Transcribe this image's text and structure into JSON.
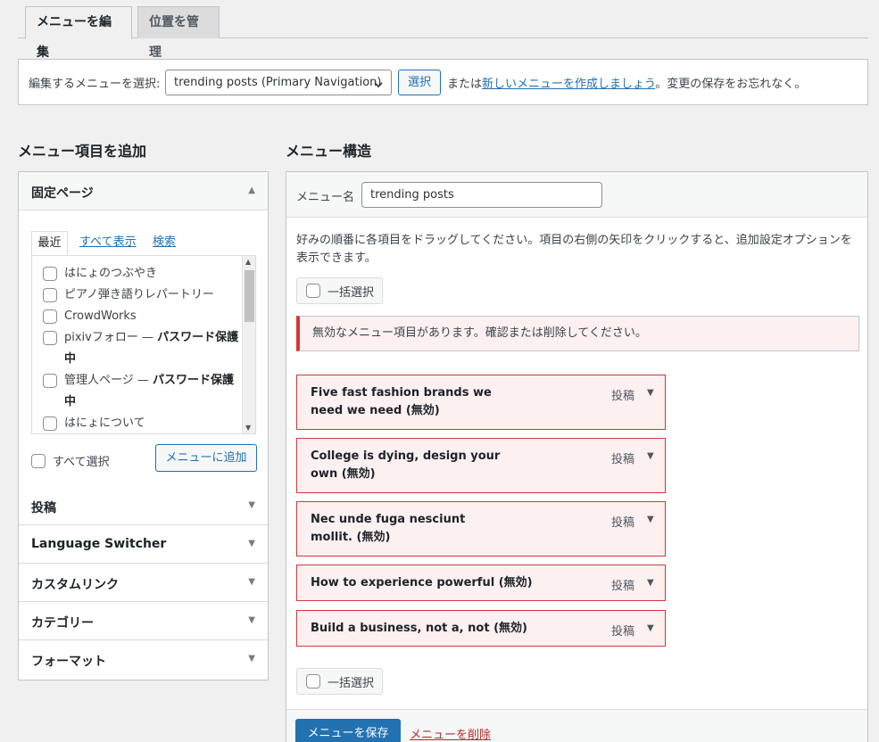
{
  "tabs": [
    {
      "label": "メニューを編集",
      "active": true
    },
    {
      "label": "位置を管理",
      "active": false
    }
  ],
  "manage": {
    "label": "編集するメニューを選択:",
    "selected_menu": "trending posts (Primary Navigation)",
    "choose_label": "選択",
    "or_text": "または",
    "create_link": "新しいメニューを作成しましょう",
    "save_reminder": "。変更の保存をお忘れなく。"
  },
  "left": {
    "heading": "メニュー項目を追加",
    "pages_section": {
      "title": "固定ページ",
      "tabs": [
        "最近",
        "すべて表示",
        "検索"
      ],
      "items": [
        {
          "label": "はにょのつぶやき",
          "suffix": ""
        },
        {
          "label": "ピアノ弾き語りレパートリー",
          "suffix": ""
        },
        {
          "label": "CrowdWorks",
          "suffix": ""
        },
        {
          "label": "pixivフォロー — ",
          "suffix": "パスワード保護中"
        },
        {
          "label": "管理人ページ — ",
          "suffix": "パスワード保護中"
        },
        {
          "label": "はにょについて",
          "suffix": ""
        }
      ],
      "select_all": "すべて選択",
      "add_button": "メニューに追加"
    },
    "sections": [
      "投稿",
      "Language Switcher",
      "カスタムリンク",
      "カテゴリー",
      "フォーマット"
    ]
  },
  "right": {
    "heading": "メニュー構造",
    "menu_name_label": "メニュー名",
    "menu_name_value": "trending posts",
    "instructions": "好みの順番に各項目をドラッグしてください。項目の右側の矢印をクリックすると、追加設定オプションを表示できます。",
    "bulk_select": "一括選択",
    "notice": "無効なメニュー項目があります。確認または削除してください。",
    "items": [
      {
        "title": "Five fast fashion brands we need we need",
        "invalid": "(無効)",
        "type": "投稿"
      },
      {
        "title": "College is dying, design your own",
        "invalid": "(無効)",
        "type": "投稿"
      },
      {
        "title": "Nec unde fuga nesciunt mollit.",
        "invalid": "(無効)",
        "type": "投稿"
      },
      {
        "title": "How to experience powerful",
        "invalid": "(無効)",
        "type": "投稿"
      },
      {
        "title": "Build a business, not a, not",
        "invalid": "(無効)",
        "type": "投稿"
      }
    ],
    "save_button": "メニューを保存",
    "delete_link": "メニューを削除"
  },
  "icons": {
    "dropdown": "chevron-down-icon",
    "collapse": "triangle-up-icon",
    "expand": "triangle-down-icon"
  },
  "colors": {
    "primary": "#2271b1",
    "error": "#d63638",
    "error_bg": "#fcf0f1",
    "delete": "#b32d2e"
  }
}
